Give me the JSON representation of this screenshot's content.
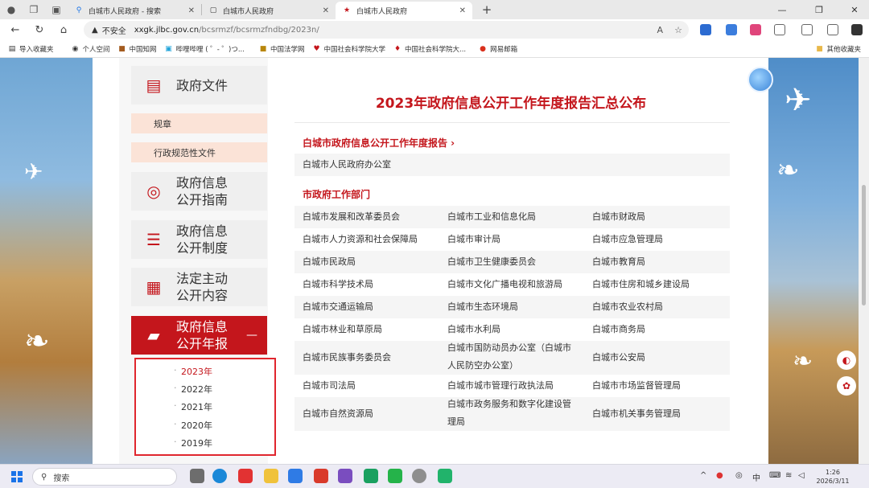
{
  "browser": {
    "tabs": [
      {
        "title": "白城市人民政府 - 搜索",
        "active": false
      },
      {
        "title": "白城市人民政府",
        "active": false
      },
      {
        "title": "白城市人民政府",
        "active": true
      }
    ],
    "url": {
      "security": "不安全",
      "domain": "xxgk.jlbc.gov.cn",
      "path": "/bcsrmzf/bcsrmzfndbg/2023n/"
    },
    "bookmarks": [
      "导入收藏夹",
      "个人空间",
      "中国知网",
      "哔哩哔哩 ( ゜- ゜)つ...",
      "中国法学网",
      "中国社会科学院大学",
      "中国社会科学院大...",
      "网易邮箱"
    ],
    "bookmarks_right": "其他收藏夹"
  },
  "sidebar": {
    "menu": [
      {
        "label": "政府文件"
      },
      {
        "label": "政府信息\n公开指南"
      },
      {
        "label": "政府信息\n公开制度"
      },
      {
        "label": "法定主动\n公开内容"
      },
      {
        "label": "政府信息\n公开年报"
      }
    ],
    "sub_items": [
      "规章",
      "行政规范性文件"
    ],
    "years": [
      "2023年",
      "2022年",
      "2021年",
      "2020年",
      "2019年"
    ],
    "collapse_symbol": "—"
  },
  "main": {
    "title": "2023年政府信息公开工作年度报告汇总公布",
    "section1_title": "白城市政府信息公开工作年度报告 ›",
    "section1_item": "白城市人民政府办公室",
    "section2_title": "市政府工作部门",
    "departments": [
      [
        "白城市发展和改革委员会",
        "白城市工业和信息化局",
        "白城市财政局"
      ],
      [
        "白城市人力资源和社会保障局",
        "白城市审计局",
        "白城市应急管理局"
      ],
      [
        "白城市民政局",
        "白城市卫生健康委员会",
        "白城市教育局"
      ],
      [
        "白城市科学技术局",
        "白城市文化广播电视和旅游局",
        "白城市住房和城乡建设局"
      ],
      [
        "白城市交通运输局",
        "白城市生态环境局",
        "白城市农业农村局"
      ],
      [
        "白城市林业和草原局",
        "白城市水利局",
        "白城市商务局"
      ],
      [
        "白城市民族事务委员会",
        "白城市国防动员办公室（白城市人民防空办公室）",
        "白城市公安局"
      ],
      [
        "白城市司法局",
        "白城市城市管理行政执法局",
        "白城市市场监督管理局"
      ],
      [
        "白城市自然资源局",
        "白城市政务服务和数字化建设管理局",
        "白城市机关事务管理局"
      ]
    ]
  },
  "taskbar": {
    "search_placeholder": "搜索",
    "ime": "中",
    "time": "1:26",
    "date": "2026/3/11"
  }
}
